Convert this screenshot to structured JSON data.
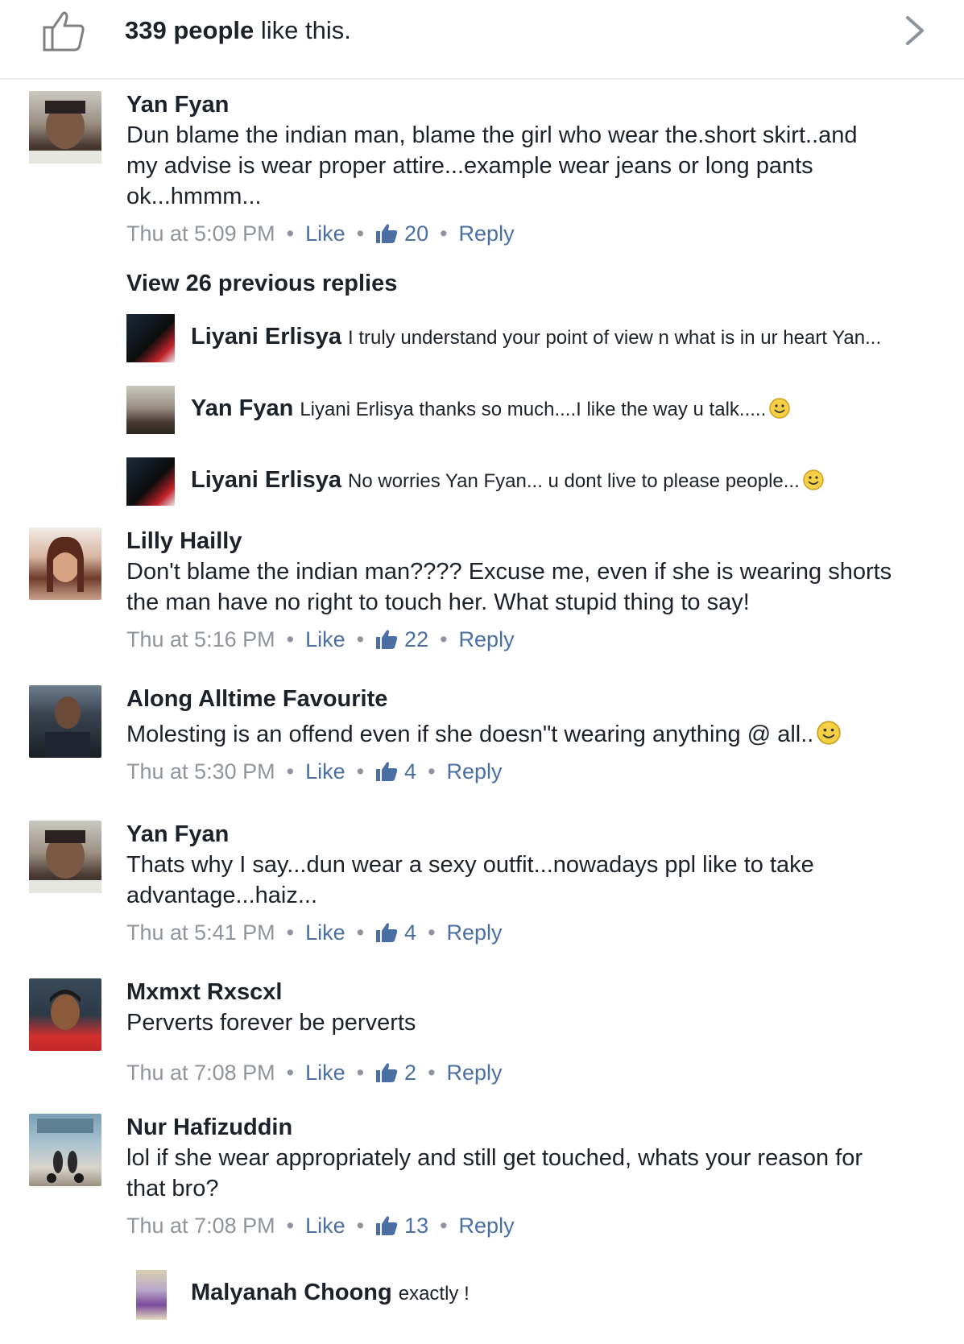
{
  "likes_bar": {
    "count_text": "339 people",
    "suffix": " like this."
  },
  "comments": [
    {
      "author": "Yan Fyan",
      "text": "Dun blame the indian man, blame the girl who wear the.short skirt..and\nmy advise is wear proper attire...example wear jeans or long pants\nok...hmmm...",
      "time": "Thu at 5:09 PM",
      "like_label": "Like",
      "like_count": "20",
      "reply_label": "Reply"
    },
    {
      "author": "Lilly Hailly",
      "text": "Don't blame the indian man???? Excuse me, even if she is wearing shorts\nthe man have no right to touch her. What stupid thing to say!",
      "time": "Thu at 5:16 PM",
      "like_label": "Like",
      "like_count": "22",
      "reply_label": "Reply"
    },
    {
      "author": "Along Alltime Favourite",
      "text": "Molesting is an offend even if she doesn\"t wearing anything @ all..",
      "time": "Thu at 5:30 PM",
      "like_label": "Like",
      "like_count": "4",
      "reply_label": "Reply"
    },
    {
      "author": "Yan Fyan",
      "text": "Thats why I say...dun wear a sexy outfit...nowadays ppl like to take\nadvantage...haiz...",
      "time": "Thu at 5:41 PM",
      "like_label": "Like",
      "like_count": "4",
      "reply_label": "Reply"
    },
    {
      "author": "Mxmxt Rxscxl",
      "text": "Perverts forever be perverts",
      "time": "Thu at 7:08 PM",
      "like_label": "Like",
      "like_count": "2",
      "reply_label": "Reply"
    },
    {
      "author": "Nur Hafizuddin",
      "text": "lol if she wear appropriately and still get touched, whats your reason for\nthat bro?",
      "time": "Thu at 7:08 PM",
      "like_label": "Like",
      "like_count": "13",
      "reply_label": "Reply"
    }
  ],
  "view_previous": "View 26 previous replies",
  "replies": [
    {
      "author": "Liyani Erlisya",
      "text": "I truly understand your point of view n what is in ur heart Yan..."
    },
    {
      "author": "Yan Fyan",
      "text": "Liyani Erlisya thanks so much....I like the way u talk....."
    },
    {
      "author": "Liyani Erlisya",
      "text": "No worries Yan Fyan... u dont live to please people..."
    },
    {
      "author": "Malyanah Choong",
      "text": "exactly !"
    }
  ],
  "colors": {
    "link": "#4b6fa3",
    "meta": "#90949c",
    "text": "#1d2129",
    "divider": "#e9ebee"
  },
  "icons": [
    "thumbs-up-outline-icon",
    "chevron-right-icon",
    "like-thumb-icon",
    "smiley-emoji-icon"
  ]
}
